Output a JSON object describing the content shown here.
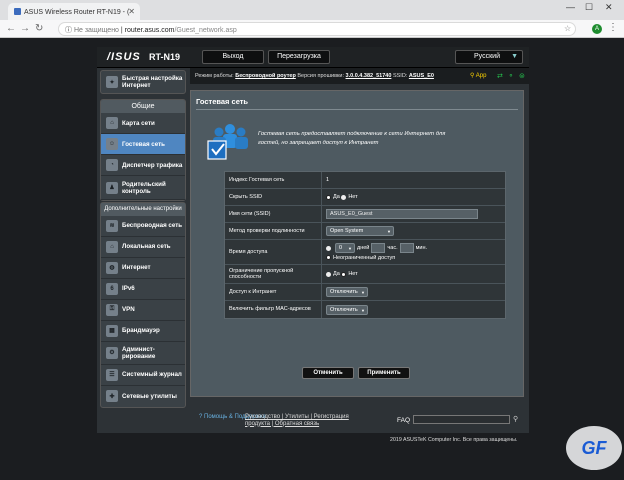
{
  "browser": {
    "tab_title": "ASUS Wireless Router RT-N19 - (",
    "not_secure": "Не защищено",
    "domain": "router.asus.com",
    "path": "/Guest_network.asp",
    "avatar": "A"
  },
  "header": {
    "logo": "/ISUS",
    "model": "RT-N19",
    "logout": "Выход",
    "reboot": "Перезагрузка",
    "language": "Русский"
  },
  "status": {
    "mode_label": "Режим работы:",
    "mode": "Беспроводной роутер",
    "fw_label": "Версия прошивки:",
    "fw": "3.0.0.4.382_51740",
    "ssid_label": "SSID:",
    "ssid": "ASUS_E0",
    "app": "App"
  },
  "sidebar": {
    "quick": "Быстрая настройка Интернет",
    "general": "Общие",
    "items": [
      "Карта сети",
      "Гостевая сеть",
      "Диспетчер трафика",
      "Родительский контроль"
    ],
    "advanced": "Дополнительные настройки",
    "adv_items": [
      "Беспроводная сеть",
      "Локальная сеть",
      "Интернет",
      "IPv6",
      "VPN",
      "Брандмауэр",
      "Админист-рирование",
      "Системный журнал",
      "Сетевые утилиты"
    ]
  },
  "panel": {
    "title": "Гостевая сеть",
    "description": "Гостевая сеть предоставляет подключение к сети Интернет для гостей, но запрещает доступ к Интранет"
  },
  "form": {
    "index_label": "Индекс Гостевая сеть",
    "index_value": "1",
    "hide_label": "Скрыть SSID",
    "yes": "Да",
    "no": "Нет",
    "ssid_label": "Имя сети (SSID)",
    "ssid_value": "ASUS_E0_Guest",
    "auth_label": "Метод проверки подлинности",
    "auth_value": "Open System",
    "time_label": "Время доступа",
    "days_value": "0",
    "days": "дней",
    "hours": "час.",
    "mins": "мин.",
    "unlimited": "Неограниченный доступ",
    "bw_label": "Ограничение пропускной способности",
    "intranet_label": "Доступ к Интранет",
    "intranet_value": "Отключить",
    "mac_label": "Включить фильтр MAC-адресов",
    "mac_value": "Отключить",
    "cancel": "Отменить",
    "apply": "Применить"
  },
  "footer": {
    "help": "Помощь & Поддержка",
    "links1": "Руководство | Утилиты | Регистрация",
    "links2": "продукта | Обратная связь",
    "faq": "FAQ",
    "copyright": "2019 ASUSTeK Computer Inc. Все права защищены."
  },
  "watermark": "GF"
}
